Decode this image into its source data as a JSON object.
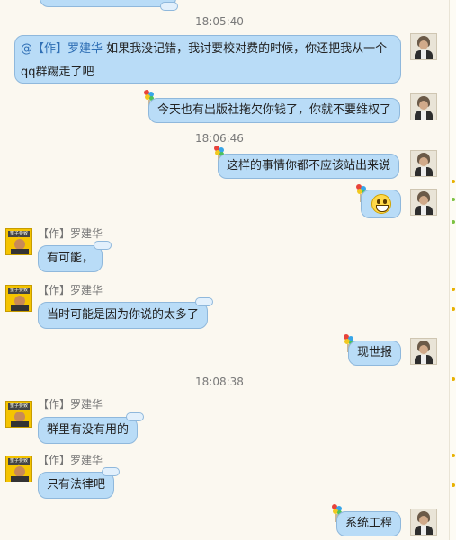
{
  "messages": {
    "ts1": "18:05:40",
    "m1_mention": "@【作】罗建华",
    "m1_text": " 如果我没记错，我讨要校对费的时候，你还把我从一个qq群踢走了吧",
    "m2": "今天也有出版社拖欠你钱了，你就不要维权了",
    "ts2": "18:06:46",
    "m3": "这样的事情你都不应该站出来说",
    "m4_emoji": "grin-emoji",
    "sender_name": "【作】罗建华",
    "m5": "有可能，",
    "m6": "当时可能是因为你说的太多了",
    "m7": "现世报",
    "ts3": "18:08:38",
    "m8": "群里有没有用的",
    "m9": "只有法律吧",
    "m10": "系统工程"
  },
  "colors": {
    "bubble": "#b9dcf7",
    "bubble_border": "#8fb8dc",
    "background": "#fbf8f0",
    "mention": "#2f6fb5"
  }
}
